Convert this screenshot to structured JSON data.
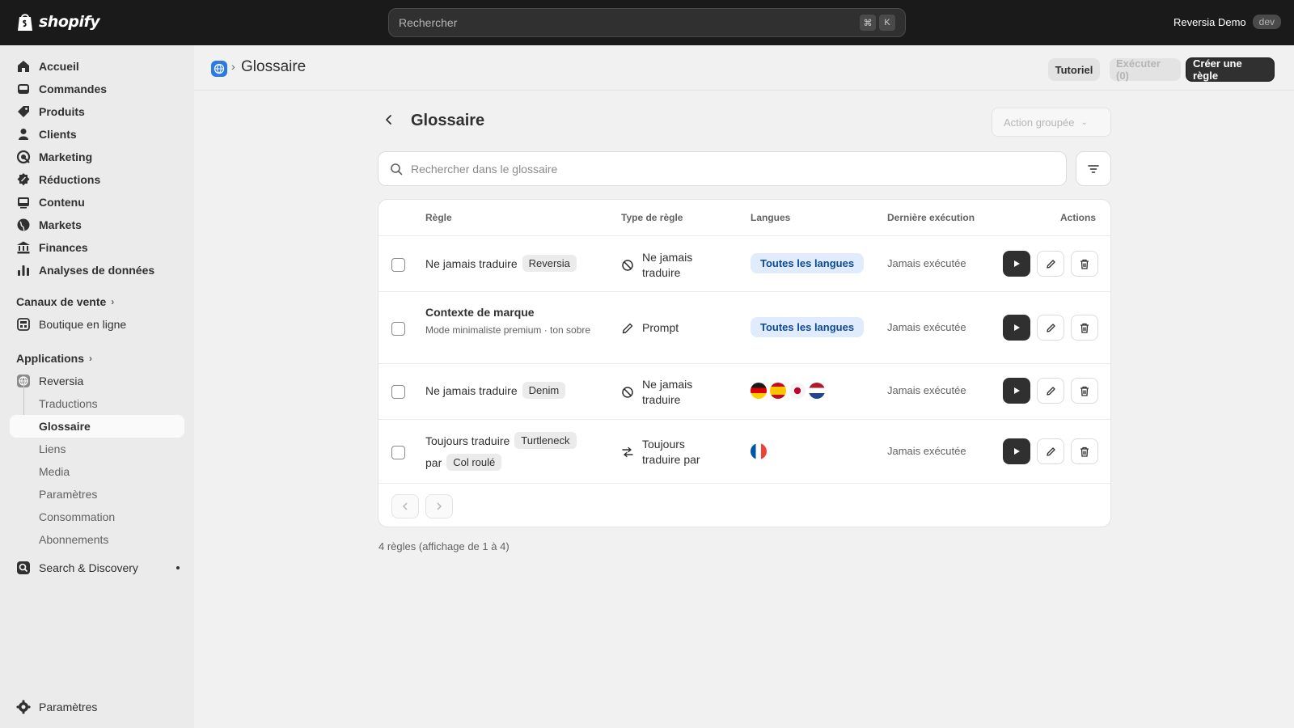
{
  "topbar": {
    "brand": "shopify",
    "search_placeholder": "Rechercher",
    "shortcut_keys": [
      "⌘",
      "K"
    ],
    "store_name": "Reversia Demo",
    "store_badge": "dev"
  },
  "sidebar": {
    "main_items": [
      {
        "label": "Accueil",
        "icon": "home-icon"
      },
      {
        "label": "Commandes",
        "icon": "inbox-icon"
      },
      {
        "label": "Produits",
        "icon": "tag-icon"
      },
      {
        "label": "Clients",
        "icon": "person-icon"
      },
      {
        "label": "Marketing",
        "icon": "target-icon"
      },
      {
        "label": "Réductions",
        "icon": "discount-icon"
      },
      {
        "label": "Contenu",
        "icon": "image-icon"
      },
      {
        "label": "Markets",
        "icon": "globe-icon"
      },
      {
        "label": "Finances",
        "icon": "bank-icon"
      },
      {
        "label": "Analyses de données",
        "icon": "bar-chart-icon"
      }
    ],
    "sales_channels_label": "Canaux de vente",
    "online_store_label": "Boutique en ligne",
    "apps_label": "Applications",
    "app_name": "Reversia",
    "app_subitems": [
      "Traductions",
      "Glossaire",
      "Liens",
      "Media",
      "Paramètres",
      "Consommation",
      "Abonnements"
    ],
    "active_subitem": "Glossaire",
    "search_discovery_label": "Search & Discovery",
    "settings_label": "Paramètres"
  },
  "header": {
    "breadcrumb_separator": "›",
    "title": "Glossaire",
    "tutorial_label": "Tutoriel",
    "execute_label": "Exécuter (0)",
    "create_label": "Créer une règle"
  },
  "main": {
    "title": "Glossaire",
    "bulk_action_label": "Action groupée",
    "search_placeholder": "Rechercher dans le glossaire",
    "columns": [
      "Règle",
      "Type de règle",
      "Langues",
      "Dernière exécution",
      "Actions"
    ],
    "rows": [
      {
        "rule": "Ne jamais traduire",
        "tag": "Reversia",
        "type": "Ne jamais traduire",
        "languages": "Toutes les langues",
        "last_run": "Jamais exécutée"
      },
      {
        "rule": "Contexte de marque",
        "subtitle": "Mode minimaliste premium · ton sobre",
        "type": "Prompt",
        "languages": "Toutes les langues",
        "last_run": "Jamais exécutée"
      },
      {
        "rule": "Ne jamais traduire",
        "tag": "Denim",
        "type": "Ne jamais traduire",
        "flags": [
          "de",
          "es",
          "jp",
          "nl"
        ],
        "last_run": "Jamais exécutée"
      },
      {
        "rule": "Toujours traduire",
        "tag": "Turtleneck",
        "connector": "par",
        "tag2": "Col roulé",
        "type": "Toujours traduire par",
        "flags": [
          "fr"
        ],
        "last_run": "Jamais exécutée"
      }
    ],
    "summary": "4 règles (affichage de 1 à 4)"
  },
  "colors": {
    "topbar_bg": "#1a1a1a",
    "primary_button": "#303030",
    "language_badge_bg": "#e0ecfb",
    "language_badge_text": "#0b4a99"
  }
}
